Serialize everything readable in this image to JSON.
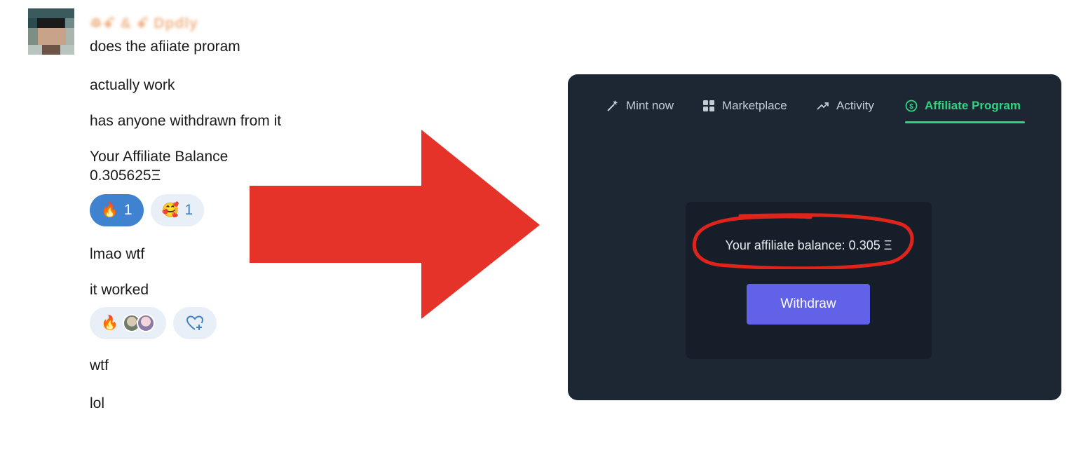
{
  "chat": {
    "username": "ꖘꗃ & ꗃ Dpdly",
    "messages": [
      "does the afiiate proram",
      "actually work",
      "has anyone withdrawn from it",
      "Your Affiliate Balance\n0.305625Ξ",
      "lmao wtf",
      "it worked",
      "wtf",
      "lol"
    ],
    "reactions_1": [
      {
        "emoji": "🔥",
        "count": "1"
      },
      {
        "emoji": "🥰",
        "count": "1"
      }
    ],
    "reactions_2": [
      {
        "emoji": "🔥"
      },
      {
        "icon": "add-reaction-icon"
      }
    ]
  },
  "panel": {
    "nav": [
      {
        "label": "Mint now",
        "icon": "magic-wand-icon"
      },
      {
        "label": "Marketplace",
        "icon": "grid-icon"
      },
      {
        "label": "Activity",
        "icon": "trend-up-icon"
      },
      {
        "label": "Affiliate Program",
        "icon": "dollar-circle-icon"
      }
    ],
    "balance_text": "Your affiliate balance: 0.305 Ξ",
    "withdraw_label": "Withdraw"
  },
  "colors": {
    "arrow": "#e63329",
    "annotation_circle": "#e0231b",
    "accent_green": "#2fd480",
    "withdraw_button": "#6262e8",
    "panel_bg": "#1d2733",
    "reaction_active": "#3f82cf"
  }
}
